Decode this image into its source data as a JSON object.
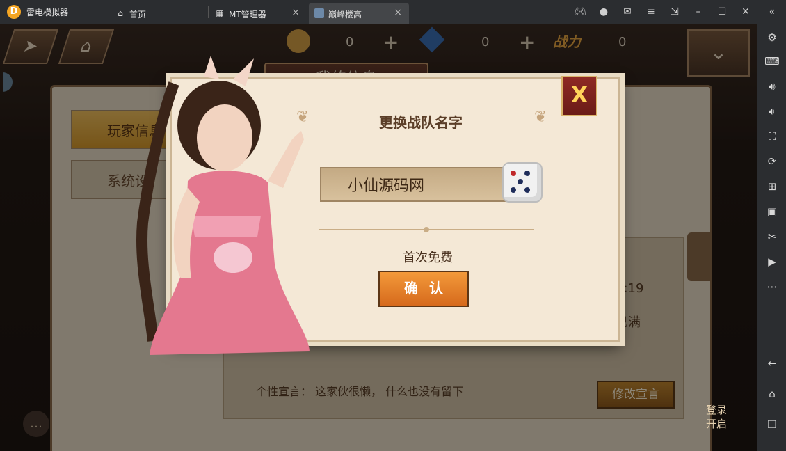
{
  "titlebar": {
    "app_title": "雷电模拟器",
    "tabs": [
      {
        "label": "首页",
        "icon": "home-icon"
      },
      {
        "label": "MT管理器",
        "icon": "mt-manager-icon"
      },
      {
        "label": "巅峰楼高",
        "icon": "game-icon",
        "active": true
      }
    ],
    "close_glyph": "×"
  },
  "hud": {
    "gold_value": "0",
    "diamond_value": "0",
    "power_label": "战力",
    "power_value": "0"
  },
  "panel": {
    "title": "我的信息",
    "side_tabs": [
      "玩家信息",
      "系统设"
    ],
    "partial_time": "6:19",
    "partial_status": "已满",
    "declaration": "个性宣言：  这家伙很懒，  什么也没有留下",
    "edit_declaration_button": "修改宣言",
    "login_text_line1": "登录",
    "login_text_line2": "开启",
    "chat_glyph": "…"
  },
  "dialog": {
    "title": "更换战队名字",
    "name_input_value": "小仙源码网",
    "free_text": "首次免费",
    "confirm_button": "确认",
    "close_glyph": "X"
  },
  "colors": {
    "accent_orange": "#e37a25",
    "parchment": "#f4e8d6",
    "title_brown": "#5b3e28",
    "close_red": "#8e2a24"
  }
}
